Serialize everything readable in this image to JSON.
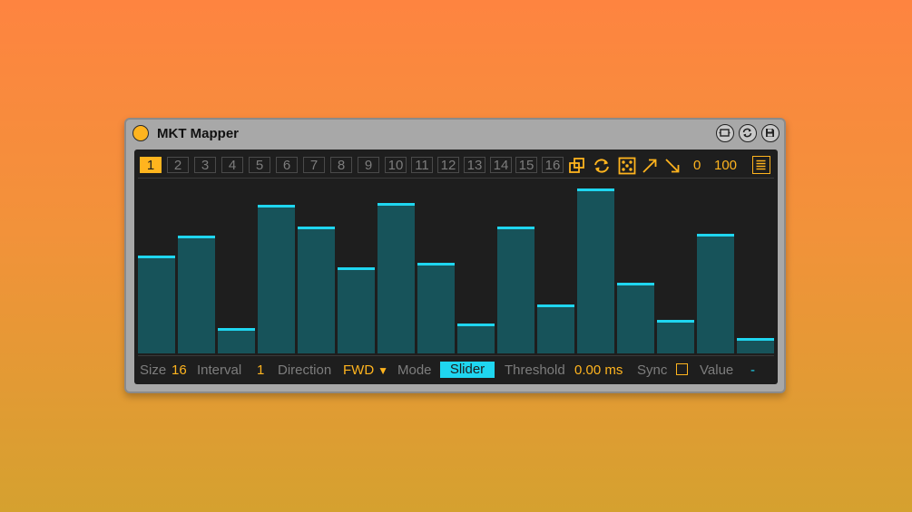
{
  "device": {
    "title": "MKT Mapper",
    "header_icons": [
      "map-icon",
      "refresh-icon",
      "save-icon"
    ]
  },
  "slots": {
    "items": [
      "1",
      "2",
      "3",
      "4",
      "5",
      "6",
      "7",
      "8",
      "9",
      "10",
      "11",
      "12",
      "13",
      "14",
      "15",
      "16"
    ],
    "active": "1"
  },
  "toolbar": {
    "icons": [
      "copy-icon",
      "cycle-icon",
      "random-dice-icon",
      "ramp-up-icon",
      "ramp-down-icon",
      "menu-icon"
    ],
    "min_value": "0",
    "max_value": "100"
  },
  "colors": {
    "accent": "#ffb41e",
    "bar_fill": "#17535a",
    "bar_cap": "#1fd6f0",
    "panel_bg": "#1e1e1e"
  },
  "bars": {
    "range": [
      0,
      100
    ],
    "values": [
      58,
      70,
      15,
      88,
      75,
      51,
      89,
      54,
      18,
      75,
      29,
      98,
      42,
      20,
      71,
      9
    ]
  },
  "footer": {
    "size_label": "Size",
    "size_value": "16",
    "interval_label": "Interval",
    "interval_value": "1",
    "direction_label": "Direction",
    "direction_value": "FWD",
    "mode_label": "Mode",
    "mode_value": "Slider",
    "threshold_label": "Threshold",
    "threshold_value": "0.00 ms",
    "sync_label": "Sync",
    "value_label": "Value",
    "value_value": "-"
  }
}
